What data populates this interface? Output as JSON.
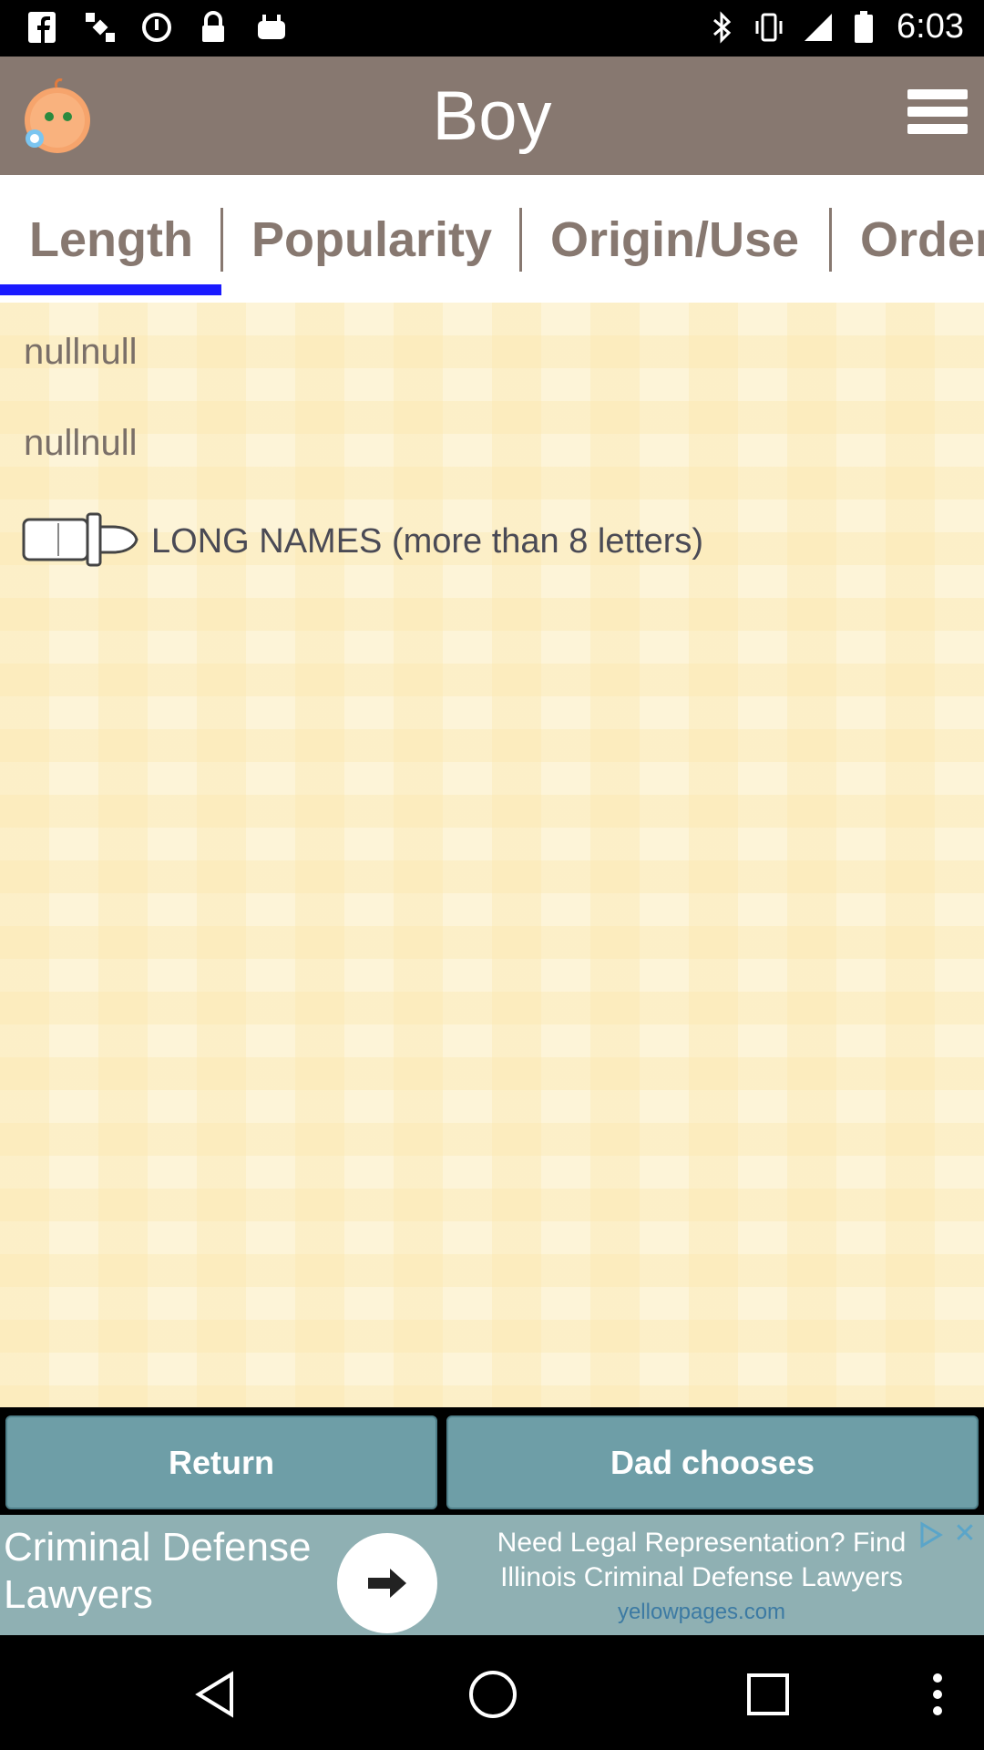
{
  "status_bar": {
    "time": "6:03",
    "left_icons": [
      "facebook-icon",
      "satellite-icon",
      "alarm-icon",
      "lock-icon",
      "android-icon"
    ],
    "right_icons": [
      "bluetooth-icon",
      "vibrate-icon",
      "signal-icon",
      "battery-icon"
    ]
  },
  "app_bar": {
    "title": "Boy",
    "logo_icon": "baby-face-icon",
    "menu_icon": "hamburger-menu-icon"
  },
  "tabs": [
    {
      "label": "Length",
      "selected": true
    },
    {
      "label": "Popularity",
      "selected": false
    },
    {
      "label": "Origin/Use",
      "selected": false
    },
    {
      "label": "Order",
      "selected": false
    }
  ],
  "list": {
    "rows": [
      "nullnull",
      "nullnull"
    ],
    "category_icon": "baby-bottle-icon",
    "category_label": "LONG NAMES (more than 8 letters)"
  },
  "buttons": {
    "return_label": "Return",
    "dad_label": "Dad chooses"
  },
  "ad": {
    "left_text_line1": "Criminal Defense",
    "left_text_line2": "Lawyers",
    "right_line1": "Need Legal Representation? Find",
    "right_line2": "Illinois Criminal Defense Lawyers",
    "source": "yellowpages.com",
    "accent": "#8fb0b3"
  },
  "nav_bar": {
    "icons": [
      "back-icon",
      "home-icon",
      "recents-icon",
      "more-icon"
    ]
  },
  "colors": {
    "appbar": "#877870",
    "tab_text": "#877870",
    "tab_indicator": "#1a1aff",
    "button": "#6e9ea7"
  }
}
